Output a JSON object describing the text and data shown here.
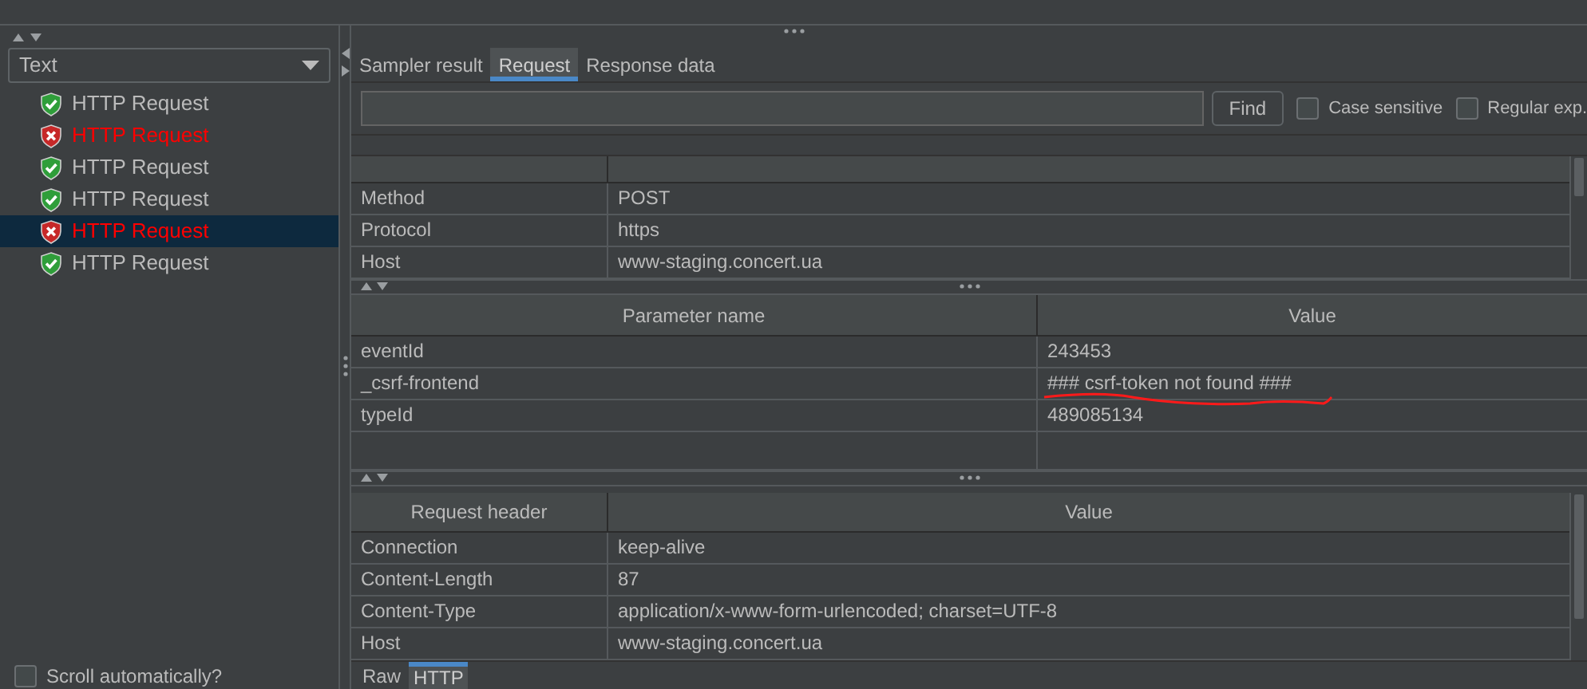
{
  "filter_dropdown": {
    "value": "Text"
  },
  "results": [
    {
      "label": "HTTP Request",
      "failed": false,
      "selected": false
    },
    {
      "label": "HTTP Request",
      "failed": true,
      "selected": false
    },
    {
      "label": "HTTP Request",
      "failed": false,
      "selected": false
    },
    {
      "label": "HTTP Request",
      "failed": false,
      "selected": false
    },
    {
      "label": "HTTP Request",
      "failed": true,
      "selected": true
    },
    {
      "label": "HTTP Request",
      "failed": false,
      "selected": false
    }
  ],
  "scroll_automatically": {
    "label": "Scroll automatically?",
    "checked": false
  },
  "tabs": [
    {
      "label": "Sampler result",
      "selected": false
    },
    {
      "label": "Request",
      "selected": true
    },
    {
      "label": "Response data",
      "selected": false
    }
  ],
  "search": {
    "button": "Find",
    "options": [
      {
        "label": "Case sensitive",
        "checked": false
      },
      {
        "label": "Regular exp.",
        "checked": false
      }
    ]
  },
  "request_table": {
    "rows": [
      {
        "name": "Method",
        "value": "POST"
      },
      {
        "name": "Protocol",
        "value": "https"
      },
      {
        "name": "Host",
        "value": "www-staging.concert.ua"
      }
    ]
  },
  "parameters_table": {
    "columns": [
      "Parameter name",
      "Value"
    ],
    "rows": [
      {
        "name": "eventId",
        "value": "243453",
        "underlined": false
      },
      {
        "name": "_csrf-frontend",
        "value": "### csrf-token not found ###",
        "underlined": true
      },
      {
        "name": "typeId",
        "value": "489085134",
        "underlined": false
      }
    ]
  },
  "headers_table": {
    "columns": [
      "Request header",
      "Value"
    ],
    "rows": [
      {
        "name": "Connection",
        "value": "keep-alive"
      },
      {
        "name": "Content-Length",
        "value": "87"
      },
      {
        "name": "Content-Type",
        "value": "application/x-www-form-urlencoded; charset=UTF-8"
      },
      {
        "name": "Host",
        "value": "www-staging.concert.ua"
      }
    ]
  },
  "bottom_tabs": [
    {
      "label": "Raw",
      "selected": false
    },
    {
      "label": "HTTP",
      "selected": true
    }
  ]
}
